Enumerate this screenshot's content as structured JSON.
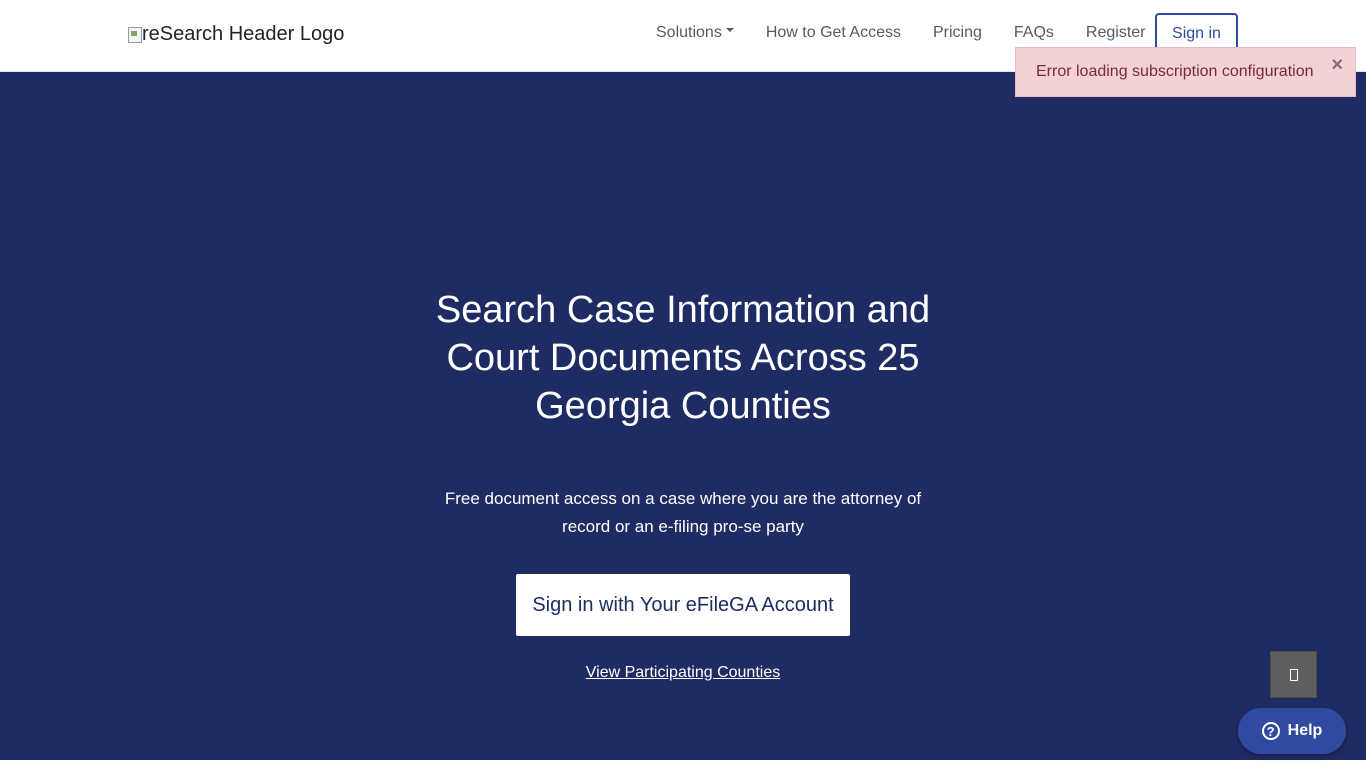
{
  "header": {
    "logo_alt": "reSearch Header Logo",
    "nav": {
      "solutions": "Solutions",
      "how_to_get_access": "How to Get Access",
      "pricing": "Pricing",
      "faqs": "FAQs",
      "register": "Register"
    },
    "sign_in": "Sign in"
  },
  "toast": {
    "message": "Error loading subscription configuration",
    "close_glyph": "×"
  },
  "hero": {
    "title": "Search Case Information and Court Documents Across 25 Georgia Counties",
    "subtitle": "Free document access on a case where you are the attorney of record or an e-filing pro-se party",
    "efile_button": "Sign in with Your eFileGA Account",
    "counties_link": "View Participating Counties"
  },
  "help": {
    "label": "Help",
    "icon_glyph": "?"
  },
  "colors": {
    "hero_bg": "#1f2c63",
    "accent": "#2f4aa0",
    "toast_bg": "#f2d2d6",
    "toast_text": "#7a2a36"
  },
  "icons": {
    "logo": "broken-image-icon",
    "solutions_dropdown": "caret-down-icon",
    "toast_close": "close-icon",
    "scroll_top": "box-icon",
    "help": "question-circle-icon"
  }
}
